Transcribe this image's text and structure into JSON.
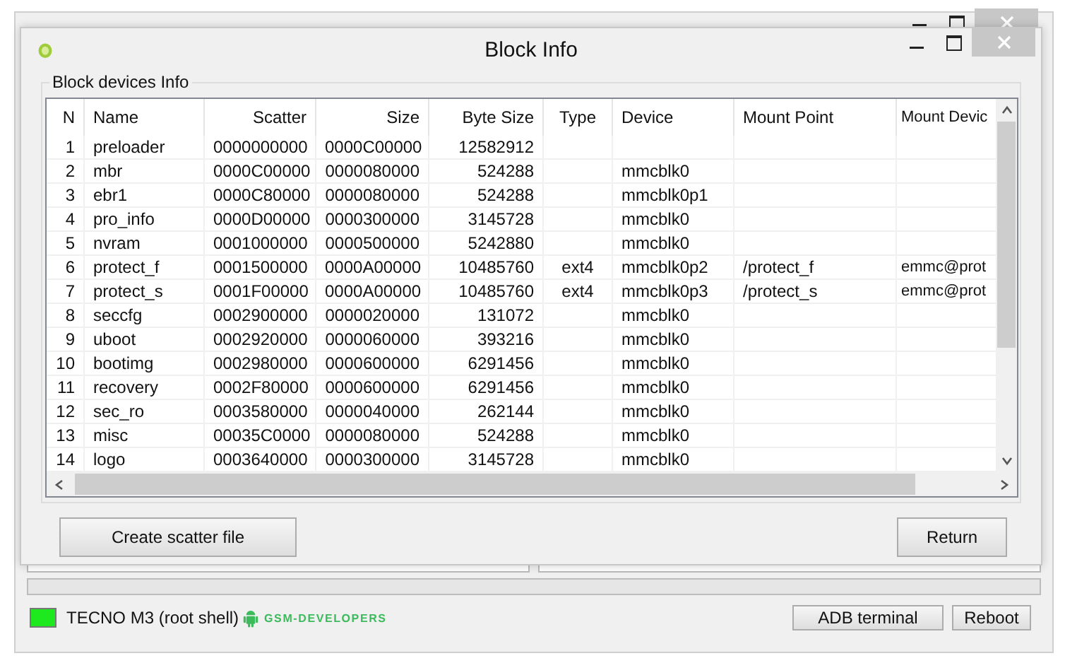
{
  "main_window": {
    "progress": {
      "level": 0
    },
    "status_text": "TECNO M3 (root shell)",
    "logo_text": "GSM-DEVELOPERS",
    "buttons": [
      "ADB terminal",
      "Reboot"
    ]
  },
  "dialog": {
    "title": "Block Info",
    "group_title": "Block devices Info",
    "table": {
      "columns": [
        "N",
        "Name",
        "Scatter",
        "Size",
        "Byte Size",
        "Type",
        "Device",
        "Mount Point",
        "Mount Devic"
      ],
      "rows": [
        [
          "1",
          "preloader",
          "0000000000",
          "0000C00000",
          "12582912",
          "",
          "",
          "",
          ""
        ],
        [
          "2",
          "mbr",
          "0000C00000",
          "0000080000",
          "524288",
          "",
          "mmcblk0",
          "",
          ""
        ],
        [
          "3",
          "ebr1",
          "0000C80000",
          "0000080000",
          "524288",
          "",
          "mmcblk0p1",
          "",
          ""
        ],
        [
          "4",
          "pro_info",
          "0000D00000",
          "0000300000",
          "3145728",
          "",
          "mmcblk0",
          "",
          ""
        ],
        [
          "5",
          "nvram",
          "0001000000",
          "0000500000",
          "5242880",
          "",
          "mmcblk0",
          "",
          ""
        ],
        [
          "6",
          "protect_f",
          "0001500000",
          "0000A00000",
          "10485760",
          "ext4",
          "mmcblk0p2",
          "/protect_f",
          "emmc@prot"
        ],
        [
          "7",
          "protect_s",
          "0001F00000",
          "0000A00000",
          "10485760",
          "ext4",
          "mmcblk0p3",
          "/protect_s",
          "emmc@prot"
        ],
        [
          "8",
          "seccfg",
          "0002900000",
          "0000020000",
          "131072",
          "",
          "mmcblk0",
          "",
          ""
        ],
        [
          "9",
          "uboot",
          "0002920000",
          "0000060000",
          "393216",
          "",
          "mmcblk0",
          "",
          ""
        ],
        [
          "10",
          "bootimg",
          "0002980000",
          "0000600000",
          "6291456",
          "",
          "mmcblk0",
          "",
          ""
        ],
        [
          "11",
          "recovery",
          "0002F80000",
          "0000600000",
          "6291456",
          "",
          "mmcblk0",
          "",
          ""
        ],
        [
          "12",
          "sec_ro",
          "0003580000",
          "0000040000",
          "262144",
          "",
          "mmcblk0",
          "",
          ""
        ],
        [
          "13",
          "misc",
          "00035C0000",
          "0000080000",
          "524288",
          "",
          "mmcblk0",
          "",
          ""
        ],
        [
          "14",
          "logo",
          "0003640000",
          "0000300000",
          "3145728",
          "",
          "mmcblk0",
          "",
          ""
        ]
      ]
    },
    "buttons": [
      "Create scatter file",
      "Return"
    ]
  }
}
